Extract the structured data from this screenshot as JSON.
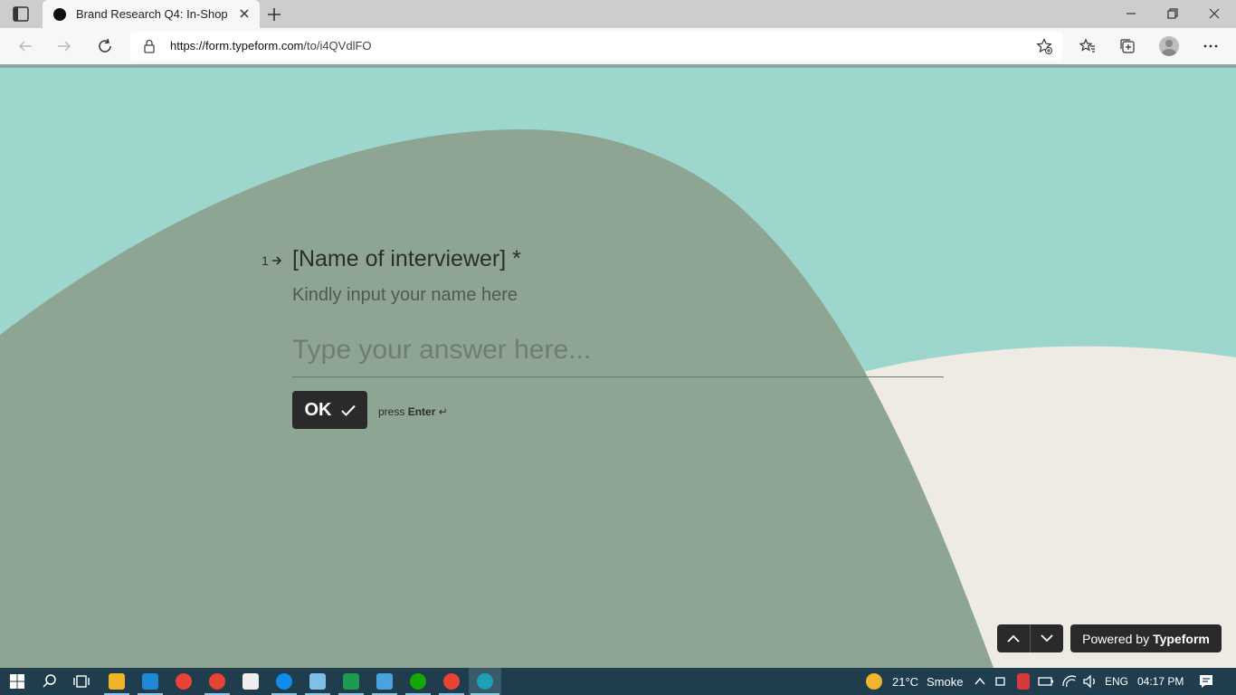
{
  "browser": {
    "tab_title": "Brand Research Q4: In-Shop",
    "url_host": "https://form.typeform.com",
    "url_path": "/to/i4QVdlFO"
  },
  "form": {
    "question_number": "1",
    "question_title": "[Name of interviewer] *",
    "question_description": "Kindly input your name here",
    "answer_placeholder": "Type your answer here...",
    "ok_label": "OK",
    "hint_prefix": "press",
    "hint_key": "Enter",
    "hint_symbol": "↵",
    "powered_prefix": "Powered by",
    "powered_brand": "Typeform"
  },
  "colors": {
    "page_background": "#9dd6cd",
    "blob_green": "#8ea593",
    "blob_cream": "#eeeae4",
    "button_dark": "#2a2a2a"
  },
  "taskbar": {
    "temperature": "21°C",
    "weather": "Smoke",
    "language": "ENG",
    "time": "04:17 PM",
    "apps": [
      "start-icon",
      "search-icon",
      "task-view-icon",
      "file-explorer-icon",
      "vscode-icon",
      "chrome-icon",
      "chrome-profile-icon",
      "terminal-icon",
      "teamviewer-icon",
      "notepad-icon",
      "excel-icon",
      "photos-icon",
      "upwork-icon",
      "chrome-icon",
      "edge-icon"
    ]
  }
}
